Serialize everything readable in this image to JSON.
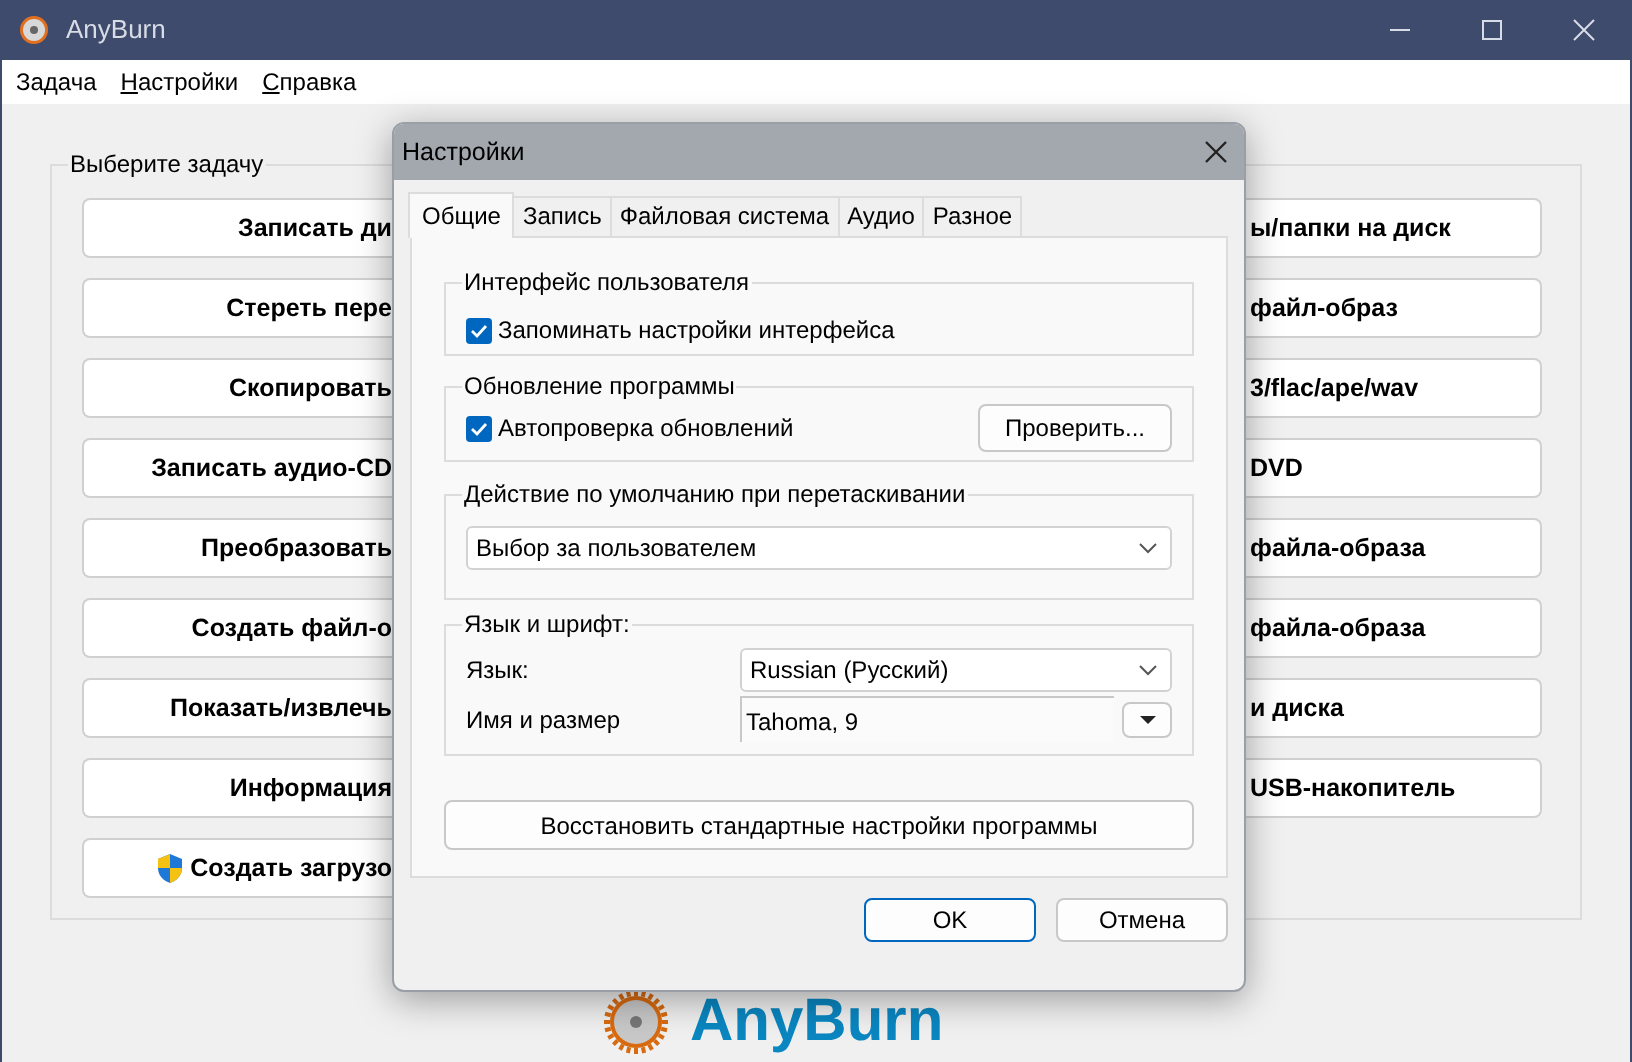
{
  "window": {
    "title": "AnyBurn"
  },
  "menu": [
    {
      "label": "Задача",
      "underline_first": false
    },
    {
      "label": "Настройки",
      "underline_first": true
    },
    {
      "label": "Справка",
      "underline_first": true
    }
  ],
  "task_group": {
    "title": "Выберите задачу",
    "left_buttons": [
      {
        "label": "Записать ди",
        "shield": false
      },
      {
        "label": "Стереть пере",
        "shield": false
      },
      {
        "label": "Скопировать",
        "shield": false
      },
      {
        "label": "Записать аудио-CD",
        "shield": false
      },
      {
        "label": "Преобразовать",
        "shield": false
      },
      {
        "label": "Создать файл-о",
        "shield": false
      },
      {
        "label": "Показать/извлечь",
        "shield": false
      },
      {
        "label": "Информация",
        "shield": false
      },
      {
        "label": "Создать загрузо",
        "shield": true
      }
    ],
    "right_buttons": [
      {
        "label": "ы/папки на диск"
      },
      {
        "label": "файл-образ"
      },
      {
        "label": "3/flac/ape/wav"
      },
      {
        "label": "DVD"
      },
      {
        "label": "файла-образа"
      },
      {
        "label": "файла-образа"
      },
      {
        "label": "и диска"
      },
      {
        "label": "USB-накопитель"
      }
    ]
  },
  "logo": {
    "text": "AnyBurn"
  },
  "dialog": {
    "title": "Настройки",
    "tabs": [
      {
        "label": "Общие",
        "selected": true
      },
      {
        "label": "Запись",
        "selected": false
      },
      {
        "label": "Файловая система",
        "selected": false
      },
      {
        "label": "Аудио",
        "selected": false
      },
      {
        "label": "Разное",
        "selected": false
      }
    ],
    "interface_group": {
      "title": "Интерфейс пользователя",
      "checkbox": {
        "label": "Запоминать настройки интерфейса",
        "checked": true
      }
    },
    "update_group": {
      "title": "Обновление программы",
      "checkbox": {
        "label": "Автопроверка обновлений",
        "checked": true
      },
      "button": "Проверить..."
    },
    "drag_group": {
      "title": "Действие по умолчанию при перетаскивании",
      "select": "Выбор за пользователем"
    },
    "language_group": {
      "title": "Язык и шрифт:",
      "language_label": "Язык:",
      "language_value": "Russian (Русский)",
      "font_label": "Имя и размер",
      "font_value": "Tahoma, 9"
    },
    "reset_button": "Восстановить стандартные настройки программы",
    "buttons": [
      {
        "label": "OK",
        "default": true
      },
      {
        "label": "Отмена",
        "default": false
      }
    ]
  }
}
